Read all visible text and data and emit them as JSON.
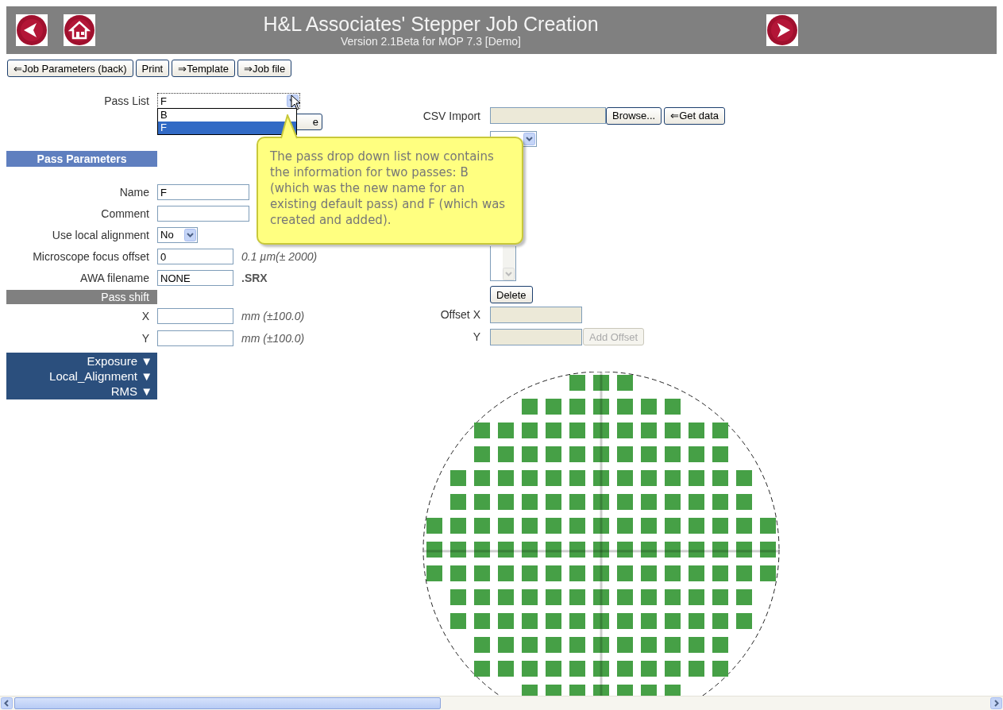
{
  "header": {
    "title": "H&L Associates' Stepper Job Creation",
    "subtitle": "Version 2.1Beta for MOP 7.3  [Demo]"
  },
  "toolbar": [
    "⇐Job Parameters (back)",
    "Print",
    "⇒Template",
    "⇒Job file"
  ],
  "pass_list": {
    "label": "Pass List",
    "value": "F",
    "expanded": true,
    "options": [
      {
        "label": "B",
        "selected": false
      },
      {
        "label": "F",
        "selected": true
      }
    ],
    "covered_button": "e"
  },
  "pass_parameters": {
    "title": "Pass Parameters",
    "fields": [
      {
        "label": "Name",
        "kind": "text",
        "value": "F"
      },
      {
        "label": "Comment",
        "kind": "text"
      },
      {
        "label": "Use local alignment",
        "kind": "select",
        "value": "No"
      },
      {
        "label": "Microscope focus offset",
        "kind": "text",
        "value": "0",
        "unit": "0.1 µm(± 2000)"
      },
      {
        "label": "AWA filename",
        "kind": "text",
        "value": "NONE",
        "suffix": ".SRX"
      }
    ]
  },
  "pass_shift": {
    "title": "Pass shift",
    "fields": [
      {
        "label": "X",
        "kind": "text",
        "unit": "mm (±100.0)"
      },
      {
        "label": "Y",
        "kind": "text",
        "unit": "mm (±100.0)"
      }
    ]
  },
  "sections": [
    "Exposure ▼",
    "Local_Alignment ▼",
    "RMS ▼"
  ],
  "csv_import": {
    "label": "CSV Import",
    "buttons": [
      "Browse...",
      "⇐Get data"
    ]
  },
  "delete_button": "Delete",
  "offset": {
    "fields": [
      {
        "label": "Offset X",
        "disabled": true
      },
      {
        "label": "Y",
        "disabled": true
      }
    ],
    "add_button": {
      "label": "Add Offset",
      "disabled": true
    }
  },
  "tooltip": "The pass drop down list now contains the information for two passes: B (which was the new name for an existing default pass) and F (which was created and added)."
}
